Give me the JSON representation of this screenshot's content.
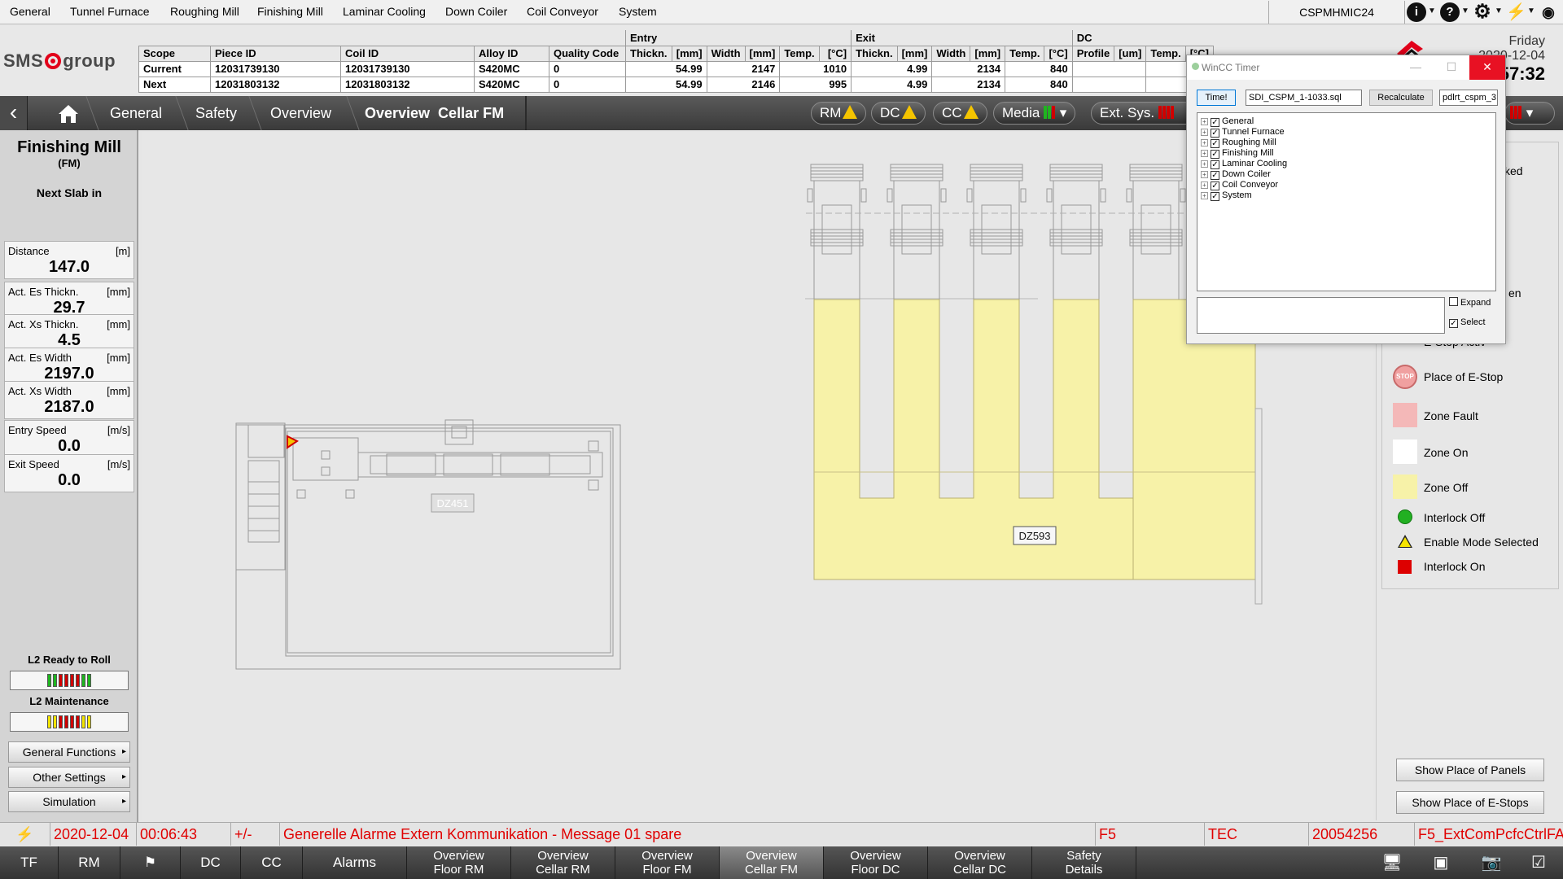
{
  "top_menu": {
    "items": [
      "General",
      "Tunnel Furnace",
      "Roughing Mill",
      "Finishing Mill",
      "Laminar Cooling",
      "Down Coiler",
      "Coil Conveyor",
      "System"
    ],
    "host": "CSPMHMIC24"
  },
  "header": {
    "logo_a": "SMS",
    "logo_b": "group",
    "day": "Friday",
    "date": "2020-12-04",
    "time": "57:32",
    "table": {
      "groups": {
        "entry": "Entry",
        "exit": "Exit",
        "dc": "DC"
      },
      "columns": [
        "Scope",
        "Piece ID",
        "Coil ID",
        "Alloy ID",
        "Quality Code",
        "Thickn.",
        "[mm]",
        "Width",
        "[mm]",
        "Temp.",
        "[°C]",
        "Thickn.",
        "[mm]",
        "Width",
        "[mm]",
        "Temp.",
        "[°C]",
        "Profile",
        "[um]",
        "Temp.",
        "[°C]"
      ],
      "rows": [
        [
          "Current",
          "12031739130",
          "12031739130",
          "S420MC",
          "0",
          "54.99",
          "2147",
          "1010",
          "4.99",
          "2134",
          "840"
        ],
        [
          "Next",
          "12031803132",
          "12031803132",
          "S420MC",
          "0",
          "54.99",
          "2146",
          "995",
          "4.99",
          "2134",
          "840"
        ]
      ]
    }
  },
  "nav": {
    "crumbs": [
      "General",
      "Safety",
      "Overview",
      "Overview  Cellar FM"
    ],
    "pills": {
      "rm": "RM",
      "dc": "DC",
      "cc": "CC",
      "media": "Media",
      "ext": "Ext. Sys."
    }
  },
  "left_panel": {
    "title": "Finishing Mill",
    "subtitle": "(FM)",
    "next_slab": "Next Slab in",
    "values": [
      {
        "label": "Distance",
        "unit": "[m]",
        "value": "147.0"
      },
      {
        "label": "Act. Es Thickn.",
        "unit": "[mm]",
        "value": "29.7"
      },
      {
        "label": "Act. Xs Thickn.",
        "unit": "[mm]",
        "value": "4.5"
      },
      {
        "label": "Act. Es Width",
        "unit": "[mm]",
        "value": "2197.0"
      },
      {
        "label": "Act. Xs Width",
        "unit": "[mm]",
        "value": "2187.0"
      },
      {
        "label": "Entry Speed",
        "unit": "[m/s]",
        "value": "0.0"
      },
      {
        "label": "Exit Speed",
        "unit": "[m/s]",
        "value": "0.0"
      }
    ],
    "l2_ready": "L2 Ready to Roll",
    "l2_maint": "L2 Maintenance",
    "buttons": [
      "General Functions",
      "Other Settings",
      "Simulation"
    ]
  },
  "canvas": {
    "zone_left": "DZ451",
    "zone_right": "DZ593"
  },
  "legend": {
    "partial_top": "cked",
    "partial_mid": "en",
    "estop_active": "E-Stop Activ",
    "stop_glyph": "STOP",
    "items": [
      "Place of E-Stop",
      "Zone Fault",
      "Zone On",
      "Zone Off",
      "Interlock Off",
      "Enable Mode Selected",
      "Interlock On"
    ],
    "colors": {
      "zone_fault": "#f4b8b8",
      "zone_on": "#ffffff",
      "zone_off": "#f7f2a8",
      "interlock_off": "#22b022",
      "enable_mode": "#f7e400",
      "interlock_on": "#dd0000"
    },
    "buttons": [
      "Show Place of Panels",
      "Show Place of E-Stops"
    ]
  },
  "wincc": {
    "title": "WinCC Timer",
    "time_btn": "Time!",
    "sql_file": "SDI_CSPM_1-1033.sql",
    "recalc_btn": "Recalculate",
    "db_name": "pdlrt_cspm_3",
    "tree": [
      "General",
      "Tunnel Furnace",
      "Roughing Mill",
      "Finishing Mill",
      "Laminar Cooling",
      "Down Coiler",
      "Coil Conveyor",
      "System"
    ],
    "expand": "Expand",
    "select": "Select"
  },
  "status": {
    "date": "2020-12-04",
    "time": "00:06:43",
    "sign": "+/-",
    "message": "Generelle Alarme Extern Kommunikation - Message 01 spare",
    "area": "F5",
    "cls": "TEC",
    "code": "20054256",
    "tag": "F5_ExtComPcfcCtrlFA"
  },
  "bottom": {
    "singles": [
      "TF",
      "RM",
      "DC",
      "CC",
      "Alarms"
    ],
    "pairs": [
      [
        "Overview",
        "Floor RM"
      ],
      [
        "Overview",
        "Cellar RM"
      ],
      [
        "Overview",
        "Floor FM"
      ],
      [
        "Overview",
        "Cellar FM"
      ],
      [
        "Overview",
        "Floor DC"
      ],
      [
        "Overview",
        "Cellar DC"
      ],
      [
        "Safety",
        "Details"
      ]
    ]
  }
}
